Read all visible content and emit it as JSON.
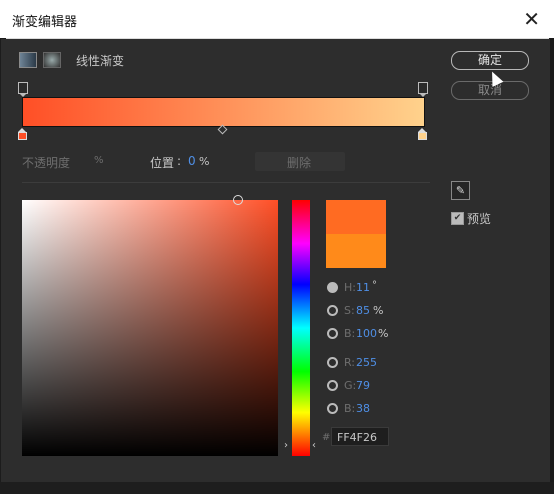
{
  "window": {
    "title": "渐变编辑器",
    "close_symbol": "✕"
  },
  "gradient": {
    "type_label": "线性渐变",
    "start_color": "#ff4f26",
    "end_color": "#ffd28c",
    "opacity_label": "不透明度",
    "opacity_unit": "%",
    "location_label": "位置",
    "location_value": "0",
    "location_unit": "%",
    "delete_label": "删除"
  },
  "buttons": {
    "ok": "确定",
    "cancel": "取消"
  },
  "preview_label": "预览",
  "picker": {
    "h_label": "H:",
    "h_value": "11",
    "h_unit": "°",
    "s_label": "S:",
    "s_value": "85",
    "s_unit": "%",
    "b_label": "B:",
    "b_value": "100",
    "b_unit": "%",
    "r_label": "R:",
    "r_value": "255",
    "g_label": "G:",
    "g_value": "79",
    "bl_label": "B:",
    "bl_value": "38",
    "hex_prefix": "#",
    "hex_value": "FF4F26",
    "arrow_left": "›",
    "arrow_right": "‹",
    "selected_mode": "H"
  },
  "colors": {
    "new_swatch": "#ff6b22",
    "old_swatch": "#ff8a1a",
    "accent": "#4f8fe6"
  },
  "icons": {
    "eyedropper": "eyedropper-icon",
    "check": "✔"
  }
}
